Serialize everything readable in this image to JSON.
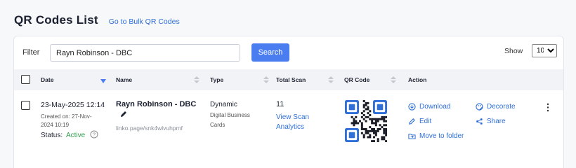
{
  "header": {
    "title": "QR Codes List",
    "bulk_link": "Go to Bulk QR Codes"
  },
  "filter": {
    "label": "Filter",
    "value": "Rayn Robinson - DBC",
    "search_label": "Search",
    "show_label": "Show",
    "show_value": "10",
    "show_options": [
      "10"
    ]
  },
  "table": {
    "columns": {
      "date": "Date",
      "name": "Name",
      "type": "Type",
      "total_scan": "Total Scan",
      "qr_code": "QR Code",
      "action": "Action"
    },
    "rows": [
      {
        "date": "23-May-2025 12:14",
        "created_line1": "Created on: 27-Nov-",
        "created_line2": "2024 10:19",
        "status_label": "Status:",
        "status_value": "Active",
        "name": "Rayn Robinson - DBC",
        "url": "linko.page/snk4wlvuhpmf",
        "type": "Dynamic",
        "subtype_line1": "Digital Business",
        "subtype_line2": "Cards",
        "scan_count": "11",
        "scan_link_line1": "View Scan",
        "scan_link_line2": "Analytics",
        "actions": {
          "download": "Download",
          "decorate": "Decorate",
          "edit": "Edit",
          "share": "Share",
          "move": "Move to folder"
        }
      }
    ]
  },
  "colors": {
    "accent": "#4a7df0",
    "link": "#2e6fd8",
    "active": "#2e9e4f",
    "header_bg": "#f2f3f6"
  }
}
